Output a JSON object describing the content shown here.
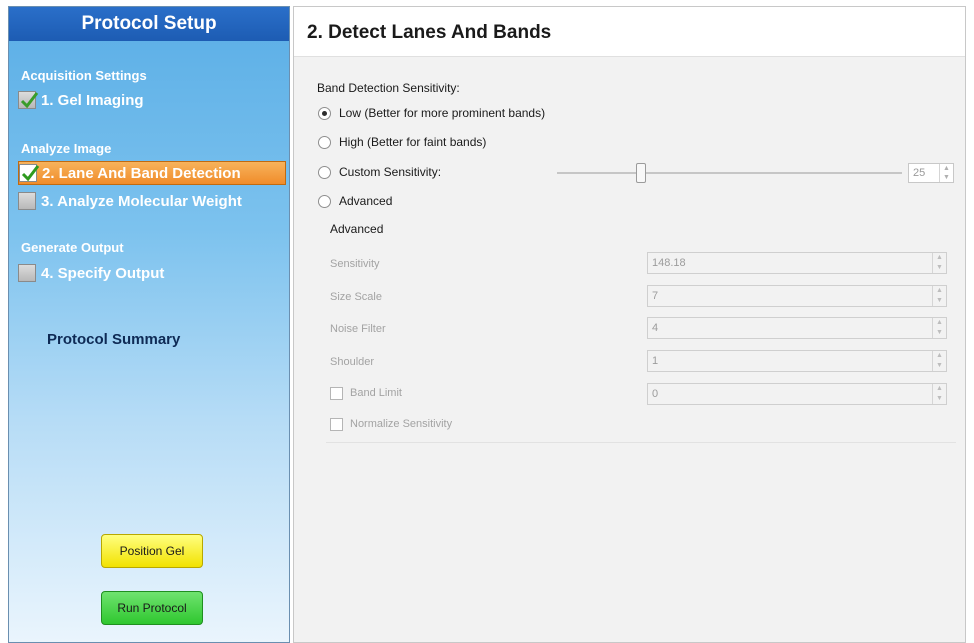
{
  "sidebar": {
    "title": "Protocol Setup",
    "groups": [
      {
        "label": "Acquisition Settings"
      },
      {
        "label": "Analyze Image"
      },
      {
        "label": "Generate Output"
      }
    ],
    "steps": [
      {
        "label": "1. Gel Imaging",
        "checked": true
      },
      {
        "label": "2. Lane And Band Detection",
        "checked": true,
        "active": true
      },
      {
        "label": "3. Analyze Molecular Weight",
        "checked": false
      },
      {
        "label": "4. Specify Output",
        "checked": false
      }
    ],
    "summary_label": "Protocol Summary",
    "buttons": {
      "position_gel": "Position Gel",
      "run_protocol": "Run Protocol"
    }
  },
  "main": {
    "title": "2. Detect Lanes And Bands",
    "sensitivity_label": "Band Detection Sensitivity:",
    "options": [
      {
        "label": "Low (Better for more prominent bands)",
        "selected": true
      },
      {
        "label": "High (Better for faint bands)",
        "selected": false
      },
      {
        "label": "Custom Sensitivity:",
        "selected": false
      },
      {
        "label": "Advanced",
        "selected": false
      }
    ],
    "custom_value": "25",
    "advanced": {
      "header": "Advanced",
      "fields": [
        {
          "label": "Sensitivity",
          "value": "148.18"
        },
        {
          "label": "Size Scale",
          "value": "7"
        },
        {
          "label": "Noise Filter",
          "value": "4"
        },
        {
          "label": "Shoulder",
          "value": "1"
        },
        {
          "label": "Band Limit",
          "value": "0"
        }
      ],
      "normalize_label": "Normalize Sensitivity"
    }
  },
  "colors": {
    "sidebar_title_bg": "#1d5cb3",
    "active_step_bg": "#f08c2a",
    "position_gel_bg": "#f2e200",
    "run_protocol_bg": "#2fc72f"
  }
}
